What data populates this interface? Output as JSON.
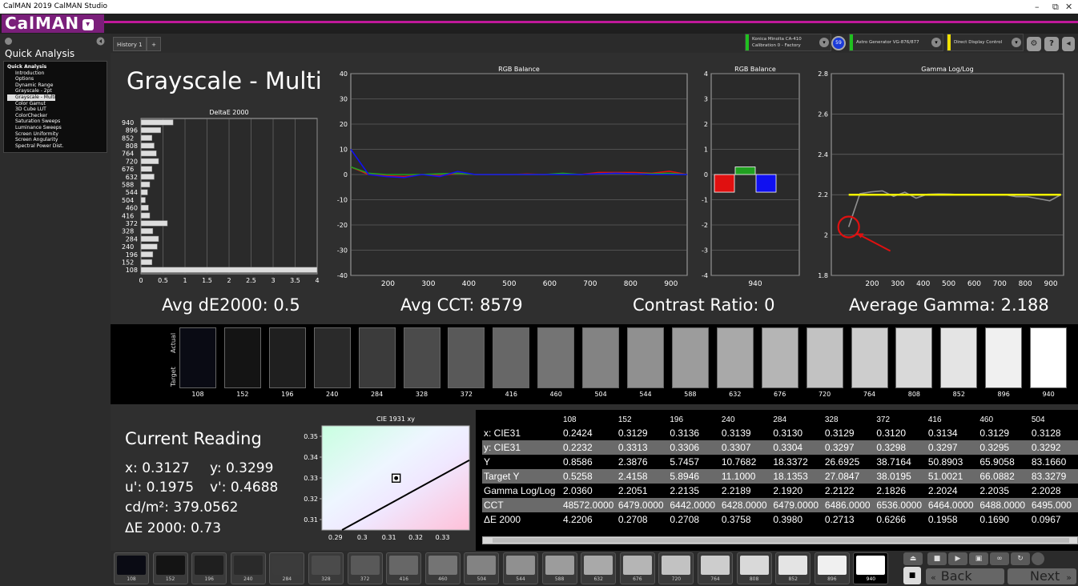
{
  "window": {
    "title": "CalMAN 2019 CalMAN Studio",
    "minimize": "–",
    "maximize": "⧉",
    "close": "✕"
  },
  "app": {
    "logo": "CalMAN",
    "logo_dropdown": "▾"
  },
  "sidebar": {
    "title": "Quick Analysis",
    "group": "Quick Analysis",
    "selected_index": 4,
    "items": [
      {
        "label": "Introduction"
      },
      {
        "label": "Options"
      },
      {
        "label": "Dynamic Range"
      },
      {
        "label": "Grayscale - 2pt"
      },
      {
        "label": "Grayscale - Multi"
      },
      {
        "label": "Color Gamut"
      },
      {
        "label": "3D Cube LUT"
      },
      {
        "label": "ColorChecker"
      },
      {
        "label": "Saturation Sweeps"
      },
      {
        "label": "Luminance Sweeps"
      },
      {
        "label": "Screen Uniformity"
      },
      {
        "label": "Screen Angularity"
      },
      {
        "label": "Spectral Power Dist."
      }
    ]
  },
  "tabs": {
    "history": "History 1",
    "add": "+"
  },
  "devices": {
    "meter_line1": "Konica Minolta CA-410",
    "meter_line2": "Calibration 0 - Factory",
    "meter_badge": "59",
    "generator": "Astro Generator VG-876/877",
    "display": "Direct Display Control",
    "gear": "⚙",
    "help": "?",
    "collapse": "◂"
  },
  "page": {
    "title": "Grayscale - Multi"
  },
  "stats": {
    "avg_de": "Avg dE2000: 0.5",
    "avg_cct": "Avg CCT: 8579",
    "contrast": "Contrast Ratio: 0",
    "avg_gamma": "Average Gamma: 2.188"
  },
  "swatches": {
    "actual_label": "Actual",
    "target_label": "Target",
    "levels": [
      "108",
      "152",
      "196",
      "240",
      "284",
      "328",
      "372",
      "416",
      "460",
      "504",
      "544",
      "588",
      "632",
      "676",
      "720",
      "764",
      "808",
      "852",
      "896",
      "940"
    ],
    "colors": [
      "#0a0b14",
      "#141414",
      "#1f1f1f",
      "#2a2a2a",
      "#3b3b3b",
      "#4b4b4b",
      "#595959",
      "#676767",
      "#747474",
      "#838383",
      "#909090",
      "#9c9c9c",
      "#a9a9a9",
      "#b5b5b5",
      "#c2c2c2",
      "#cdcdcd",
      "#d9d9d9",
      "#e4e4e4",
      "#f0f0f0",
      "#ffffff"
    ]
  },
  "current_reading": {
    "title": "Current Reading",
    "x": "x: 0.3127",
    "y": "y: 0.3299",
    "u": "u': 0.1975",
    "v": "v': 0.4688",
    "cd": "cd/m²: 379.0562",
    "de": "ΔE 2000: 0.73"
  },
  "table": {
    "columns": [
      "108",
      "152",
      "196",
      "240",
      "284",
      "328",
      "372",
      "416",
      "460",
      "504"
    ],
    "rows": [
      {
        "label": "x: CIE31",
        "values": [
          "0.2424",
          "0.3129",
          "0.3136",
          "0.3139",
          "0.3130",
          "0.3129",
          "0.3120",
          "0.3134",
          "0.3129",
          "0.3128"
        ]
      },
      {
        "label": "y: CIE31",
        "values": [
          "0.2232",
          "0.3313",
          "0.3306",
          "0.3307",
          "0.3304",
          "0.3297",
          "0.3298",
          "0.3297",
          "0.3295",
          "0.3292"
        ]
      },
      {
        "label": "Y",
        "values": [
          "0.8586",
          "2.3876",
          "5.7457",
          "10.7682",
          "18.3372",
          "26.6925",
          "38.7164",
          "50.8903",
          "65.9058",
          "83.1660"
        ]
      },
      {
        "label": "Target Y",
        "values": [
          "0.5258",
          "2.4158",
          "5.8946",
          "11.1000",
          "18.1353",
          "27.0847",
          "38.0195",
          "51.0021",
          "66.0882",
          "83.3279"
        ]
      },
      {
        "label": "Gamma Log/Log",
        "values": [
          "2.0360",
          "2.2051",
          "2.2135",
          "2.2189",
          "2.1920",
          "2.2122",
          "2.1826",
          "2.2024",
          "2.2035",
          "2.2028"
        ]
      },
      {
        "label": "CCT",
        "values": [
          "48572.0000",
          "6479.0000",
          "6442.0000",
          "6428.0000",
          "6479.0000",
          "6486.0000",
          "6536.0000",
          "6464.0000",
          "6488.0000",
          "6495.000"
        ]
      },
      {
        "label": "ΔE 2000",
        "values": [
          "4.2206",
          "0.2708",
          "0.2708",
          "0.3758",
          "0.3980",
          "0.2713",
          "0.6266",
          "0.1958",
          "0.1690",
          "0.0967"
        ]
      }
    ]
  },
  "bottom": {
    "levels": [
      "108",
      "152",
      "196",
      "240",
      "284",
      "328",
      "372",
      "416",
      "460",
      "504",
      "544",
      "588",
      "632",
      "676",
      "720",
      "764",
      "808",
      "852",
      "896",
      "940"
    ],
    "selected": "940",
    "back": "Back",
    "next": "Next"
  },
  "chart_data": [
    {
      "type": "bar",
      "title": "DeltaE 2000",
      "orientation": "horizontal",
      "categories": [
        "108",
        "152",
        "196",
        "240",
        "284",
        "328",
        "372",
        "416",
        "460",
        "504",
        "544",
        "588",
        "632",
        "676",
        "720",
        "764",
        "808",
        "852",
        "896",
        "940"
      ],
      "values": [
        4.0,
        0.25,
        0.27,
        0.37,
        0.4,
        0.27,
        0.6,
        0.2,
        0.17,
        0.1,
        0.15,
        0.2,
        0.3,
        0.25,
        0.4,
        0.35,
        0.3,
        0.25,
        0.45,
        0.73
      ],
      "xlim": [
        0,
        4
      ],
      "xticks": [
        "0",
        "0.5",
        "1",
        "1.5",
        "2",
        "2.5",
        "3",
        "3.5",
        "4"
      ],
      "ylabels": [
        "940",
        "896",
        "852",
        "808",
        "764",
        "720",
        "676",
        "632",
        "588",
        "544",
        "504",
        "460",
        "416",
        "372",
        "328",
        "284",
        "240",
        "196",
        "152",
        "108"
      ]
    },
    {
      "type": "line",
      "title": "RGB Balance",
      "x": [
        108,
        152,
        196,
        240,
        284,
        328,
        372,
        416,
        460,
        504,
        544,
        588,
        632,
        676,
        720,
        764,
        808,
        852,
        896,
        940
      ],
      "ylim": [
        -40,
        40
      ],
      "yticks": [
        "40",
        "30",
        "20",
        "10",
        "0",
        "-10",
        "-20",
        "-30",
        "-40"
      ],
      "xticks": [
        "200",
        "300",
        "400",
        "500",
        "600",
        "700",
        "800",
        "900"
      ],
      "series": [
        {
          "name": "Red",
          "color": "#e01010",
          "values": [
            3,
            0,
            -0.5,
            -0.8,
            0,
            -0.5,
            0.5,
            0,
            0,
            0,
            0.2,
            0,
            0.3,
            0,
            0.8,
            0.8,
            0.8,
            0.5,
            1.3,
            0
          ]
        },
        {
          "name": "Green",
          "color": "#20a020",
          "values": [
            3,
            0.5,
            0,
            0,
            0,
            0.3,
            0.5,
            0,
            0,
            0,
            0,
            0,
            0.5,
            0,
            0.3,
            0.5,
            0.3,
            0.3,
            0.5,
            0
          ]
        },
        {
          "name": "Blue",
          "color": "#1010f0",
          "values": [
            10,
            0,
            -0.8,
            -1.2,
            0,
            -0.8,
            1.2,
            0,
            0,
            0,
            0,
            0,
            0,
            0,
            0.3,
            0.5,
            0.3,
            0,
            0,
            0
          ]
        }
      ]
    },
    {
      "type": "bar",
      "title": "RGB Balance",
      "categories": [
        "940"
      ],
      "series": [
        {
          "name": "Red",
          "color": "#e01010",
          "values": [
            -0.7
          ]
        },
        {
          "name": "Green",
          "color": "#20a020",
          "values": [
            0.3
          ]
        },
        {
          "name": "Blue",
          "color": "#1010f0",
          "values": [
            -0.7
          ]
        }
      ],
      "ylim": [
        -4,
        4
      ],
      "yticks": [
        "4",
        "3",
        "2",
        "1",
        "0",
        "-1",
        "-2",
        "-3",
        "-4"
      ]
    },
    {
      "type": "line",
      "title": "Gamma Log/Log",
      "x": [
        108,
        152,
        196,
        240,
        284,
        328,
        372,
        416,
        460,
        504,
        544,
        588,
        632,
        676,
        720,
        764,
        808,
        852,
        896,
        940
      ],
      "ylim": [
        1.8,
        2.8
      ],
      "yticks": [
        "2.8",
        "2.6",
        "2.4",
        "2.2",
        "2",
        "1.8"
      ],
      "xticks": [
        "200",
        "300",
        "400",
        "500",
        "600",
        "700",
        "800",
        "900"
      ],
      "target": 2.2,
      "series": [
        {
          "name": "Gamma",
          "color": "#909090",
          "values": [
            2.04,
            2.205,
            2.214,
            2.219,
            2.192,
            2.212,
            2.183,
            2.202,
            2.204,
            2.203,
            2.2,
            2.2,
            2.2,
            2.2,
            2.2,
            2.19,
            2.19,
            2.18,
            2.17,
            2.2
          ]
        },
        {
          "name": "Target",
          "color": "#f0f000",
          "values": [
            2.2,
            2.2,
            2.2,
            2.2,
            2.2,
            2.2,
            2.2,
            2.2,
            2.2,
            2.2,
            2.2,
            2.2,
            2.2,
            2.2,
            2.2,
            2.2,
            2.2,
            2.2,
            2.2,
            2.2
          ]
        }
      ]
    },
    {
      "type": "scatter",
      "title": "CIE 1931 xy",
      "xlim": [
        0.285,
        0.34
      ],
      "ylim": [
        0.305,
        0.355
      ],
      "xticks": [
        "0.29",
        "0.3",
        "0.31",
        "0.32",
        "0.33"
      ],
      "yticks": [
        "0.35",
        "0.34",
        "0.33",
        "0.32",
        "0.31"
      ],
      "points": [
        {
          "x": 0.3127,
          "y": 0.3299
        }
      ]
    }
  ]
}
